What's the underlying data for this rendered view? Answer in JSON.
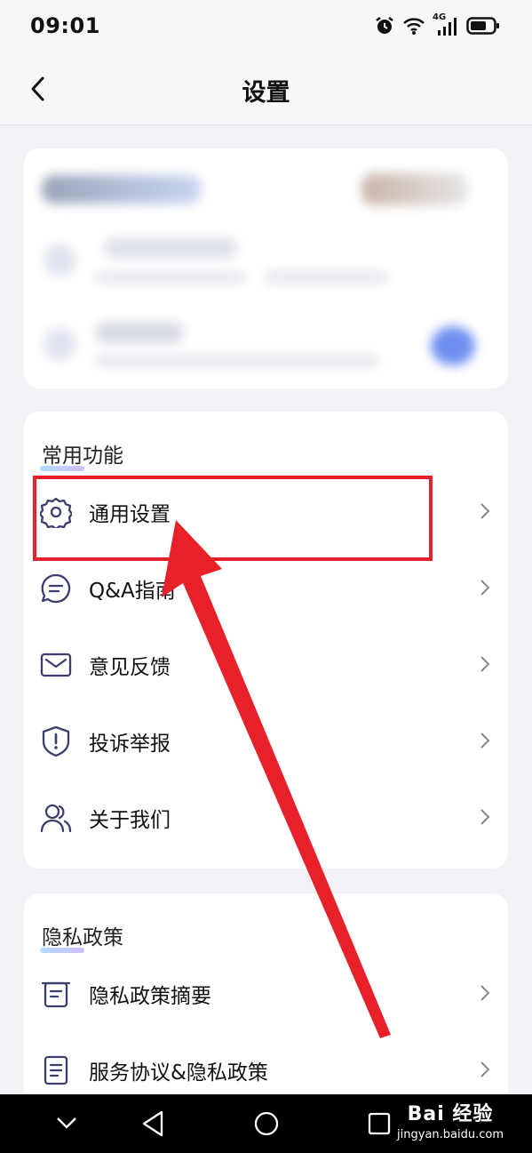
{
  "status_bar": {
    "time": "09:01",
    "network": "4G"
  },
  "header": {
    "title": "设置"
  },
  "common": {
    "section_title": "常用功能",
    "items": [
      {
        "label": "通用设置",
        "icon": "gear-icon"
      },
      {
        "label": "Q&A指南",
        "icon": "chat-bubble-icon"
      },
      {
        "label": "意见反馈",
        "icon": "envelope-icon"
      },
      {
        "label": "投诉举报",
        "icon": "shield-exclamation-icon"
      },
      {
        "label": "关于我们",
        "icon": "users-icon"
      }
    ]
  },
  "privacy": {
    "section_title": "隐私政策",
    "items": [
      {
        "label": "隐私政策摘要",
        "icon": "document-list-icon"
      },
      {
        "label": "服务协议&隐私政策",
        "icon": "document-icon"
      }
    ]
  },
  "watermark": {
    "brand": "Bai 经验",
    "url": "jingyan.baidu.com"
  },
  "colors": {
    "icon": "#3a3f6e",
    "highlight_box": "#e8202a",
    "arrow": "#e8202a",
    "background": "#f2f3f7"
  }
}
